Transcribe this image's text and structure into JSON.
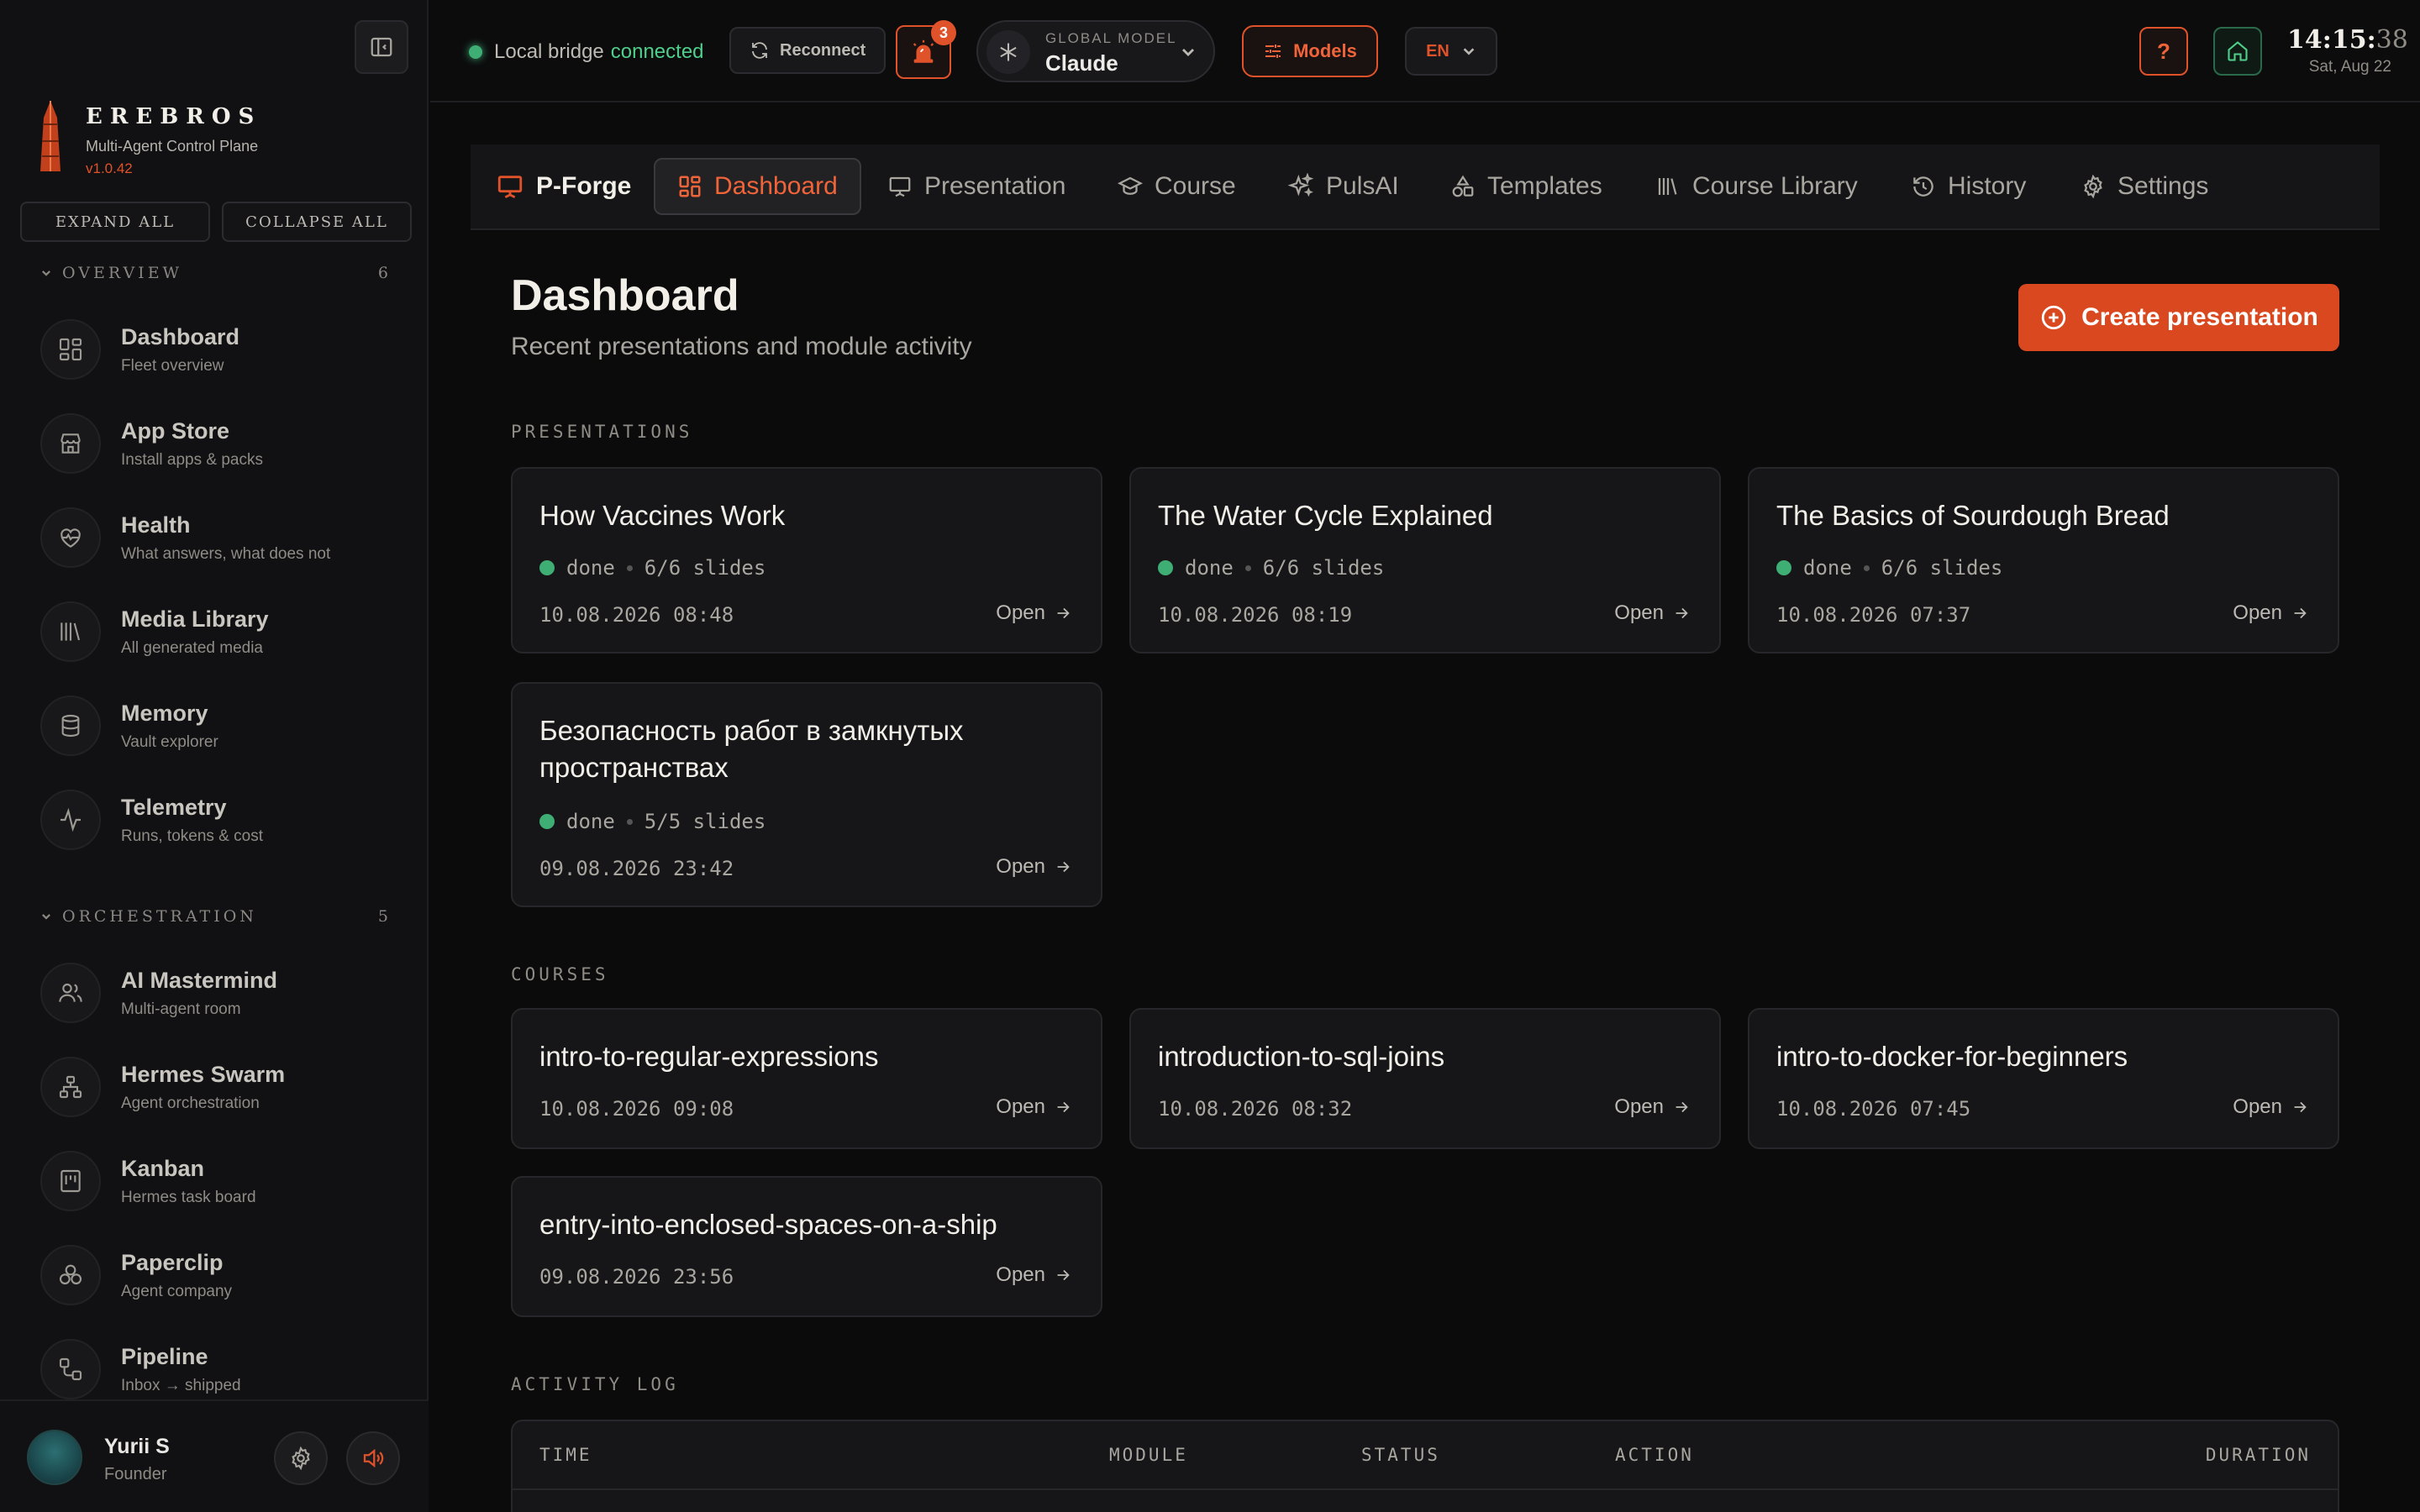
{
  "app": {
    "name": "EREBROS",
    "subtitle": "Multi-Agent Control Plane",
    "version": "v1.0.42",
    "accent": "#e0522a"
  },
  "sidebar": {
    "expand_all": "EXPAND ALL",
    "collapse_all": "COLLAPSE ALL",
    "sections": [
      {
        "title": "OVERVIEW",
        "count": "6",
        "items": [
          {
            "label": "Dashboard",
            "sub": "Fleet overview",
            "icon": "grid-icon"
          },
          {
            "label": "App Store",
            "sub": "Install apps & packs",
            "icon": "store-icon"
          },
          {
            "label": "Health",
            "sub": "What answers, what does not",
            "icon": "heart-pulse-icon"
          },
          {
            "label": "Media Library",
            "sub": "All generated media",
            "icon": "library-icon"
          },
          {
            "label": "Memory",
            "sub": "Vault explorer",
            "icon": "database-icon"
          },
          {
            "label": "Telemetry",
            "sub": "Runs, tokens & cost",
            "icon": "activity-icon"
          }
        ]
      },
      {
        "title": "ORCHESTRATION",
        "count": "5",
        "items": [
          {
            "label": "AI Mastermind",
            "sub": "Multi-agent room",
            "icon": "users-icon"
          },
          {
            "label": "Hermes Swarm",
            "sub": "Agent orchestration",
            "icon": "network-icon"
          },
          {
            "label": "Kanban",
            "sub": "Hermes task board",
            "icon": "kanban-icon"
          },
          {
            "label": "Paperclip",
            "sub": "Agent company",
            "icon": "circles-icon"
          },
          {
            "label": "Pipeline",
            "sub": "Inbox → shipped",
            "icon": "pipeline-icon"
          }
        ]
      }
    ],
    "user": {
      "name": "Yurii S",
      "role": "Founder"
    }
  },
  "topbar": {
    "bridge_label": "Local bridge",
    "bridge_status": "connected",
    "reconnect": "Reconnect",
    "alerts_count": "3",
    "global_model_label": "GLOBAL MODEL",
    "global_model_value": "Claude",
    "models_button": "Models",
    "language": "EN",
    "help": "?",
    "clock_hm": "14:15:",
    "clock_s": "38",
    "date": "Sat, Aug 22"
  },
  "tabs": [
    {
      "label": "P-Forge",
      "icon": "presentation-icon"
    },
    {
      "label": "Dashboard",
      "icon": "grid-icon"
    },
    {
      "label": "Presentation",
      "icon": "presentation-icon"
    },
    {
      "label": "Course",
      "icon": "graduation-cap-icon"
    },
    {
      "label": "PulsAI",
      "icon": "sparkles-icon"
    },
    {
      "label": "Templates",
      "icon": "shapes-icon"
    },
    {
      "label": "Course Library",
      "icon": "library-icon"
    },
    {
      "label": "History",
      "icon": "history-icon"
    },
    {
      "label": "Settings",
      "icon": "gear-icon"
    }
  ],
  "main": {
    "title": "Dashboard",
    "subtitle": "Recent presentations and module activity",
    "create_button": "Create presentation",
    "presentations_label": "PRESENTATIONS",
    "presentations": [
      {
        "title": "How Vaccines Work",
        "status": "done",
        "slides": "6/6 slides",
        "date": "10.08.2026 08:48",
        "open": "Open"
      },
      {
        "title": "The Water Cycle Explained",
        "status": "done",
        "slides": "6/6 slides",
        "date": "10.08.2026 08:19",
        "open": "Open"
      },
      {
        "title": "The Basics of Sourdough Bread",
        "status": "done",
        "slides": "6/6 slides",
        "date": "10.08.2026 07:37",
        "open": "Open"
      },
      {
        "title": "Безопасность работ в замкнутых пространствах",
        "status": "done",
        "slides": "5/5 slides",
        "date": "09.08.2026 23:42",
        "open": "Open"
      }
    ],
    "courses_label": "COURSES",
    "courses": [
      {
        "title": "intro-to-regular-expressions",
        "date": "10.08.2026 09:08",
        "open": "Open"
      },
      {
        "title": "introduction-to-sql-joins",
        "date": "10.08.2026 08:32",
        "open": "Open"
      },
      {
        "title": "intro-to-docker-for-beginners",
        "date": "10.08.2026 07:45",
        "open": "Open"
      },
      {
        "title": "entry-into-enclosed-spaces-on-a-ship",
        "date": "09.08.2026 23:56",
        "open": "Open"
      }
    ],
    "activity_label": "ACTIVITY LOG",
    "activity_columns": [
      "TIME",
      "MODULE",
      "STATUS",
      "ACTION",
      "DURATION"
    ]
  }
}
